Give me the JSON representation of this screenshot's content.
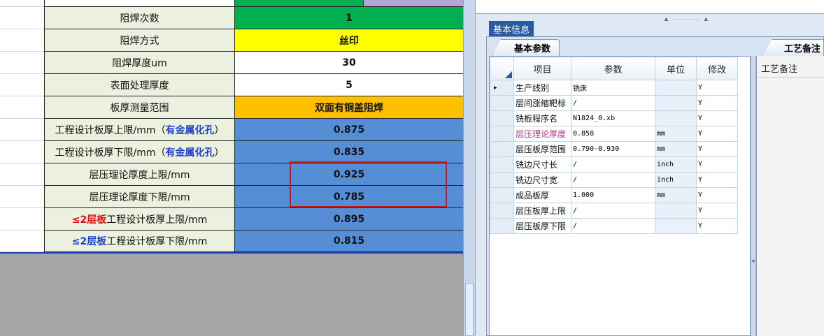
{
  "sheet": {
    "rows": [
      {
        "label": "阻焊次数",
        "value": "1"
      },
      {
        "label": "阻焊方式",
        "value": "丝印"
      },
      {
        "label": "阻焊厚度um",
        "value": "30"
      },
      {
        "label": "表面处理厚度",
        "value": "5"
      },
      {
        "label": "板厚测量范围",
        "value": "双面有铜盖阻焊"
      },
      {
        "label_main": "工程设计板厚上限/mm（",
        "label_blue": "有金属化孔",
        "label_end": "）",
        "value": "0.875"
      },
      {
        "label_main": "工程设计板厚下限/mm（",
        "label_blue": "有金属化孔",
        "label_end": "）",
        "value": "0.835"
      },
      {
        "label": "层压理论厚度上限/mm",
        "value": "0.925"
      },
      {
        "label": "层压理论厚度下限/mm",
        "value": "0.785"
      },
      {
        "label_prefix": "≤2层板",
        "label_rest": "工程设计板厚上限/mm",
        "value": "0.895"
      },
      {
        "label_prefix": "≤2层板",
        "label_rest": "工程设计板厚下限/mm",
        "value": "0.815"
      }
    ],
    "colors": {
      "green": "#00b050",
      "yellow": "#ffff00",
      "orange": "#ffc000",
      "blue_cell": "#558ed5",
      "lavender": "#b4a7d6",
      "label_bg": "#ebf1de",
      "selection": "#cc1a1a"
    }
  },
  "panel": {
    "main_tab": "基本信息",
    "subtab_basic": "基本参数",
    "subtab_notes": "工艺备注",
    "notes_label": "工艺备注",
    "columns": [
      "项目",
      "参数",
      "单位",
      "修改"
    ],
    "current_row_marker": "▸",
    "rows": [
      {
        "item": "生产线别",
        "param": "铣床",
        "unit": "",
        "mod": "Y"
      },
      {
        "item": "层间涨缩靶标",
        "param": "/",
        "unit": "",
        "mod": "Y"
      },
      {
        "item": "铣板程序名",
        "param": "N1824_0.xb",
        "unit": "",
        "mod": "Y"
      },
      {
        "item": "层压理论厚度",
        "param": "0.858",
        "unit": "mm",
        "mod": "Y"
      },
      {
        "item": "层压板厚范围",
        "param": "0.790-0.930",
        "unit": "mm",
        "mod": "Y"
      },
      {
        "item": "铣边尺寸长",
        "param": "/",
        "unit": "inch",
        "mod": "Y"
      },
      {
        "item": "铣边尺寸宽",
        "param": "/",
        "unit": "inch",
        "mod": "Y"
      },
      {
        "item": "成品板厚",
        "param": "1.000",
        "unit": "mm",
        "mod": "Y"
      },
      {
        "item": "层压板厚上限",
        "param": "/",
        "unit": "",
        "mod": "Y"
      },
      {
        "item": "层压板厚下限",
        "param": "/",
        "unit": "",
        "mod": "Y"
      }
    ]
  }
}
